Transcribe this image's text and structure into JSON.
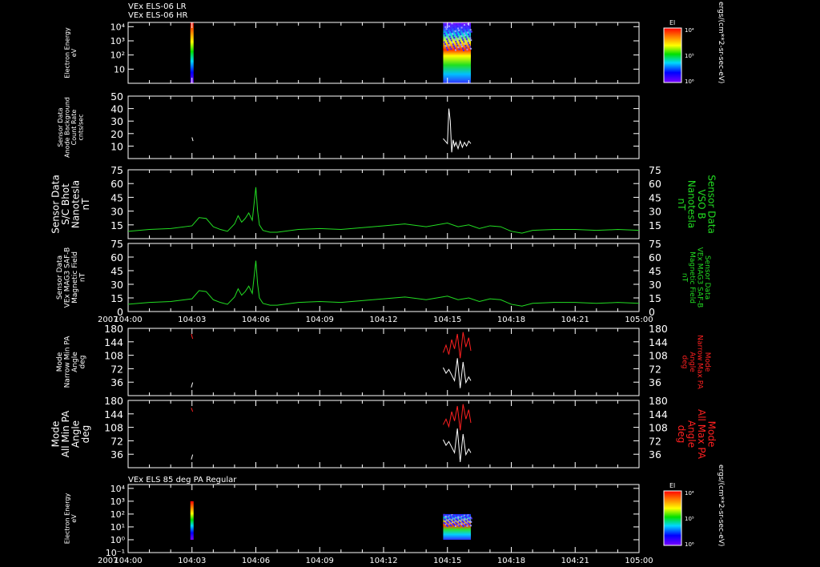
{
  "header": {
    "line1": "VEx ELS-06 LR",
    "line2": "VEx ELS-06 HR",
    "bottom_panel_title": "VEx ELS 85 deg PA Regular"
  },
  "colors": {
    "background": "#000000",
    "frame": "#ffffff",
    "green_trace": "#22dd22",
    "red_trace": "#ff2020",
    "white_trace": "#ffffff"
  },
  "colorbar": {
    "label": "El",
    "units": "ergs/(cm**2-sr-sec-eV)",
    "ticks": [
      "10⁴",
      "10⁵",
      "10⁶"
    ]
  },
  "colorbar_bottom": {
    "label": "El",
    "units": "ergs/(cm**2-sr-sec-eV)",
    "ticks": [
      "10⁴",
      "10⁵",
      "10⁶"
    ]
  },
  "time_axis": {
    "year": "2007",
    "ticks": [
      "104:00",
      "104:03",
      "104:06",
      "104:09",
      "104:12",
      "104:15",
      "104:18",
      "104:21",
      "105:00"
    ]
  },
  "chart_data": [
    {
      "type": "heatmap",
      "id": "els_lr_hr",
      "ylabel": "Electron Energy\neV",
      "ytick_labels": [
        "10",
        "10²",
        "10³",
        "10⁴"
      ],
      "yscale": "log",
      "ylim": [
        1,
        20000
      ],
      "x_ticks": [
        "104:00",
        "104:03",
        "104:06",
        "104:09",
        "104:12",
        "104:15",
        "104:18",
        "104:21",
        "105:00"
      ],
      "blocks": [
        {
          "x": [
            "104:03",
            "104:03"
          ],
          "y": [
            1,
            20000
          ]
        },
        {
          "x": [
            "104:14:48",
            "104:16:06"
          ],
          "y": [
            1,
            20000
          ]
        }
      ]
    },
    {
      "type": "line",
      "id": "anode_background",
      "ylabel": "Sensor Data\nAnode Background\nCount Rate\ncnts/sec",
      "yticks": [
        10,
        20,
        30,
        40,
        50
      ],
      "ylim": [
        0,
        50
      ],
      "series": [
        {
          "color": "#ffffff",
          "x": [
            "104:03:00",
            "104:03:03"
          ],
          "y": [
            17,
            14
          ]
        },
        {
          "color": "#ffffff",
          "x": [
            "104:14:48",
            "104:15:00",
            "104:15:04",
            "104:15:08",
            "104:15:12",
            "104:15:16",
            "104:15:20",
            "104:15:24",
            "104:15:30",
            "104:15:36",
            "104:15:42",
            "104:15:48",
            "104:15:54",
            "104:16:00",
            "104:16:06"
          ],
          "y": [
            16,
            12,
            40,
            30,
            5,
            15,
            10,
            13,
            8,
            14,
            9,
            13,
            10,
            14,
            12
          ]
        }
      ]
    },
    {
      "type": "line",
      "id": "sc_bhot",
      "ylabel": "Sensor Data\nS/C Bhot\nNanotesla\nnT",
      "right_label": "Sensor Data\nVSO B\nNanotesla\nnT",
      "yticks": [
        15,
        30,
        45,
        60,
        75
      ],
      "ylim": [
        0,
        75
      ],
      "series": [
        {
          "color": "#22dd22",
          "x": [
            "104:00",
            "104:01",
            "104:02",
            "104:03",
            "104:03:20",
            "104:03:40",
            "104:04",
            "104:04:20",
            "104:04:40",
            "104:05",
            "104:05:10",
            "104:05:20",
            "104:05:30",
            "104:05:40",
            "104:05:50",
            "104:06",
            "104:06:05",
            "104:06:10",
            "104:06:20",
            "104:06:40",
            "104:07",
            "104:08",
            "104:09",
            "104:10",
            "104:11",
            "104:12",
            "104:13",
            "104:14",
            "104:15",
            "104:15:30",
            "104:16",
            "104:16:30",
            "104:17",
            "104:17:30",
            "104:18",
            "104:18:30",
            "104:19",
            "104:20",
            "104:21",
            "104:22",
            "104:23",
            "105:00"
          ],
          "y": [
            8,
            10,
            11,
            14,
            23,
            22,
            13,
            10,
            8,
            16,
            25,
            18,
            22,
            28,
            20,
            56,
            30,
            15,
            9,
            7,
            7,
            10,
            11,
            10,
            12,
            14,
            16,
            13,
            17,
            13,
            15,
            11,
            14,
            13,
            8,
            6,
            9,
            10,
            10,
            9,
            10,
            9
          ]
        }
      ]
    },
    {
      "type": "line",
      "id": "mag_field",
      "ylabel": "Sensor Data\nVEx MAG3 SAF-B\nMagnetic Field\nnT",
      "right_label": "Sensor Data\nVEx MAG3 SAF-B\nMagnetic Field\nnT",
      "yticks": [
        0,
        15,
        30,
        45,
        60,
        75
      ],
      "ylim": [
        0,
        75
      ],
      "series": [
        {
          "color": "#22dd22",
          "x": [
            "104:00",
            "104:01",
            "104:02",
            "104:03",
            "104:03:20",
            "104:03:40",
            "104:04",
            "104:04:20",
            "104:04:40",
            "104:05",
            "104:05:10",
            "104:05:20",
            "104:05:30",
            "104:05:40",
            "104:05:50",
            "104:06",
            "104:06:05",
            "104:06:10",
            "104:06:20",
            "104:06:40",
            "104:07",
            "104:08",
            "104:09",
            "104:10",
            "104:11",
            "104:12",
            "104:13",
            "104:14",
            "104:15",
            "104:15:30",
            "104:16",
            "104:16:30",
            "104:17",
            "104:17:30",
            "104:18",
            "104:18:30",
            "104:19",
            "104:20",
            "104:21",
            "104:22",
            "104:23",
            "105:00"
          ],
          "y": [
            8,
            10,
            11,
            14,
            23,
            22,
            13,
            10,
            8,
            16,
            25,
            18,
            22,
            28,
            20,
            56,
            30,
            15,
            9,
            7,
            7,
            10,
            11,
            10,
            12,
            14,
            16,
            13,
            17,
            13,
            15,
            11,
            14,
            13,
            8,
            6,
            9,
            10,
            10,
            9,
            10,
            9
          ]
        }
      ]
    },
    {
      "type": "line",
      "id": "narrow_pa",
      "ylabel": "Mode\nNarrow Min PA\nAngle\ndeg",
      "right_label": "Mode\nNarrow Max PA\nAngle\ndeg",
      "yticks": [
        36,
        72,
        108,
        144,
        180
      ],
      "ylim": [
        0,
        180
      ],
      "series": [
        {
          "color": "#ff2020",
          "x": [
            "104:02:58",
            "104:03:02"
          ],
          "y": [
            165,
            152
          ]
        },
        {
          "color": "#ffffff",
          "x": [
            "104:02:58",
            "104:03:02"
          ],
          "y": [
            22,
            35
          ]
        },
        {
          "color": "#ff2020",
          "x": [
            "104:14:48",
            "104:14:56",
            "104:15:04",
            "104:15:12",
            "104:15:20",
            "104:15:28",
            "104:15:36",
            "104:15:44",
            "104:15:52",
            "104:16:00",
            "104:16:06"
          ],
          "y": [
            115,
            135,
            110,
            150,
            125,
            165,
            100,
            170,
            130,
            155,
            120
          ]
        },
        {
          "color": "#ffffff",
          "x": [
            "104:14:48",
            "104:14:56",
            "104:15:04",
            "104:15:12",
            "104:15:20",
            "104:15:28",
            "104:15:36",
            "104:15:44",
            "104:15:52",
            "104:16:00",
            "104:16:06"
          ],
          "y": [
            75,
            60,
            70,
            55,
            40,
            100,
            20,
            90,
            35,
            50,
            40
          ]
        }
      ]
    },
    {
      "type": "line",
      "id": "all_pa",
      "ylabel": "Mode\nAll Min PA\nAngle\ndeg",
      "right_label": "Mode\nAll Max PA\nAngle\ndeg",
      "yticks": [
        36,
        72,
        108,
        144,
        180
      ],
      "ylim": [
        0,
        180
      ],
      "series": [
        {
          "color": "#ff2020",
          "x": [
            "104:02:58",
            "104:03:02"
          ],
          "y": [
            160,
            150
          ]
        },
        {
          "color": "#ffffff",
          "x": [
            "104:02:58",
            "104:03:02"
          ],
          "y": [
            22,
            35
          ]
        },
        {
          "color": "#ff2020",
          "x": [
            "104:14:48",
            "104:14:56",
            "104:15:04",
            "104:15:12",
            "104:15:20",
            "104:15:28",
            "104:15:36",
            "104:15:44",
            "104:15:52",
            "104:16:00",
            "104:16:06"
          ],
          "y": [
            115,
            130,
            110,
            150,
            125,
            165,
            100,
            170,
            130,
            155,
            120
          ]
        },
        {
          "color": "#ffffff",
          "x": [
            "104:14:48",
            "104:14:56",
            "104:15:04",
            "104:15:12",
            "104:15:20",
            "104:15:28",
            "104:15:36",
            "104:15:44",
            "104:15:52",
            "104:16:00",
            "104:16:06"
          ],
          "y": [
            75,
            60,
            70,
            55,
            40,
            105,
            15,
            90,
            35,
            50,
            40
          ]
        }
      ]
    },
    {
      "type": "heatmap",
      "id": "els_85deg",
      "ylabel": "Electron Energy\neV",
      "ytick_labels": [
        "10⁻¹",
        "10⁰",
        "10¹",
        "10²",
        "10³",
        "10⁴"
      ],
      "yscale": "log",
      "ylim": [
        0.1,
        20000
      ],
      "x_ticks": [
        "104:00",
        "104:03",
        "104:06",
        "104:09",
        "104:12",
        "104:15",
        "104:18",
        "104:21",
        "105:00"
      ],
      "blocks": [
        {
          "x": [
            "104:03",
            "104:03"
          ],
          "y": [
            1,
            1000
          ]
        },
        {
          "x": [
            "104:14:48",
            "104:16:06"
          ],
          "y": [
            1,
            100
          ]
        }
      ]
    }
  ]
}
